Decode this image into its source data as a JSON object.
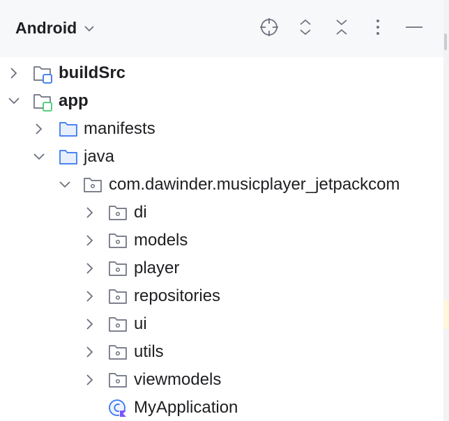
{
  "header": {
    "title": "Android",
    "tools": [
      "locate-icon",
      "expand-all-icon",
      "collapse-all-icon",
      "more-options-icon",
      "minimize-icon"
    ]
  },
  "tree": [
    {
      "label": "buildSrc",
      "bold": true,
      "expanded": false,
      "icon": "module-folder-icon"
    },
    {
      "label": "app",
      "bold": true,
      "expanded": true,
      "icon": "android-module-folder-icon"
    },
    {
      "label": "manifests",
      "expanded": false,
      "icon": "folder-icon"
    },
    {
      "label": "java",
      "expanded": true,
      "icon": "folder-icon"
    },
    {
      "label": "com.dawinder.musicplayer_jetpackcom",
      "expanded": true,
      "icon": "package-icon"
    },
    {
      "label": "di",
      "expanded": false,
      "icon": "package-icon"
    },
    {
      "label": "models",
      "expanded": false,
      "icon": "package-icon"
    },
    {
      "label": "player",
      "expanded": false,
      "icon": "package-icon"
    },
    {
      "label": "repositories",
      "expanded": false,
      "icon": "package-icon"
    },
    {
      "label": "ui",
      "expanded": false,
      "icon": "package-icon"
    },
    {
      "label": "utils",
      "expanded": false,
      "icon": "package-icon"
    },
    {
      "label": "viewmodels",
      "expanded": false,
      "icon": "package-icon"
    },
    {
      "label": "MyApplication",
      "icon": "kotlin-class-icon"
    }
  ]
}
